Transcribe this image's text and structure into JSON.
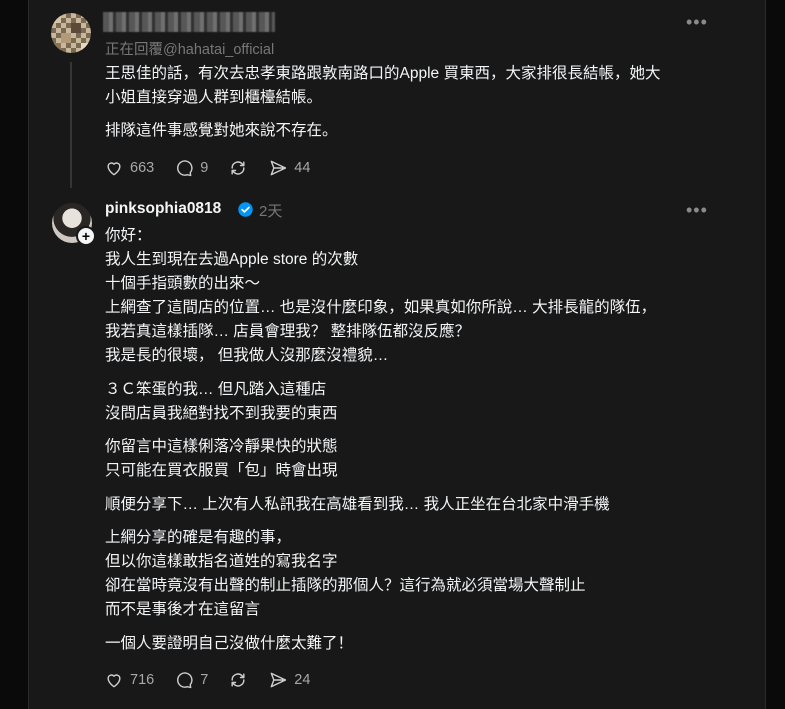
{
  "post1": {
    "replying_to": "正在回覆@hahatai_official",
    "more": "•••",
    "paragraphs": [
      "王思佳的話，有次去忠孝東路跟敦南路口的Apple 買東西，大家排很長結帳，她大",
      "小姐直接穿過人群到櫃檯結帳。",
      "排隊這件事感覺對她來說不存在。"
    ],
    "likes": "663",
    "comments": "9",
    "shares": "44"
  },
  "post2": {
    "username": "pinksophia0818",
    "time": "2天",
    "more": "•••",
    "lines": [
      "你好：",
      "我人生到現在去過Apple store 的次數",
      "十個手指頭數的出來～",
      "上網查了這間店的位置… 也是沒什麼印象，如果真如你所說… 大排長龍的隊伍，",
      "我若真這樣插隊… 店員會理我？ 整排隊伍都沒反應？",
      "我是長的很壞， 但我做人沒那麼沒禮貌…",
      "３Ｃ笨蛋的我… 但凡踏入這種店",
      "沒問店員我絕對找不到我要的東西",
      "你留言中這樣俐落冷靜果快的狀態",
      "只可能在買衣服買「包」時會出現",
      "順便分享下… 上次有人私訊我在高雄看到我… 我人正坐在台北家中滑手機",
      "上網分享的確是有趣的事，",
      "但以你這樣敢指名道姓的寫我名字",
      "卻在當時竟沒有出聲的制止插隊的那個人？這行為就必須當場大聲制止",
      "而不是事後才在這留言",
      "一個人要證明自己沒做什麼太難了！"
    ],
    "likes": "716",
    "comments": "7",
    "shares": "24"
  },
  "icons": {
    "like": "heart-icon",
    "comment": "comment-icon",
    "repost": "repost-icon",
    "share": "send-icon",
    "verified_color": "#0095f6"
  }
}
